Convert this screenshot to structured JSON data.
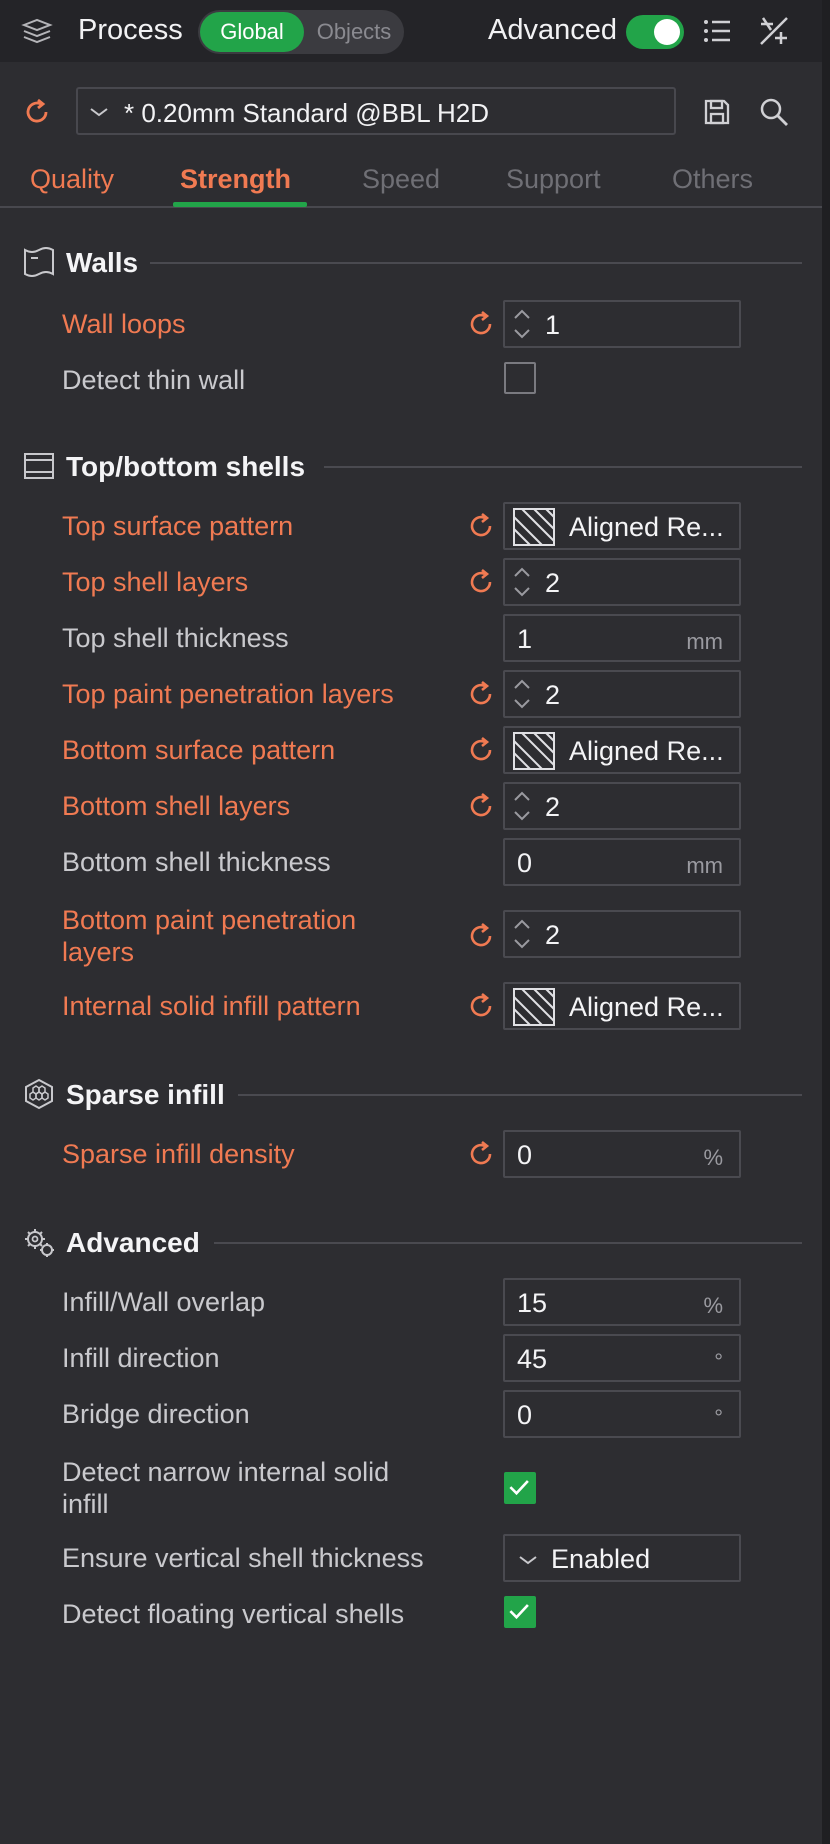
{
  "header": {
    "title": "Process",
    "seg_global": "Global",
    "seg_objects": "Objects",
    "advanced_label": "Advanced",
    "advanced_on": true
  },
  "preset": {
    "name": "* 0.20mm Standard @BBL H2D"
  },
  "tabs": [
    {
      "label": "Quality"
    },
    {
      "label": "Strength"
    },
    {
      "label": "Speed"
    },
    {
      "label": "Support"
    },
    {
      "label": "Others"
    }
  ],
  "active_tab": "Strength",
  "colors": {
    "accent_green": "#22a449",
    "modified_orange": "#f07a52",
    "background": "#2d2d31"
  },
  "walls": {
    "title": "Walls",
    "wall_loops": {
      "label": "Wall loops",
      "value": "1"
    },
    "detect_thin_wall": {
      "label": "Detect thin wall",
      "checked": false
    }
  },
  "top_bottom": {
    "title": "Top/bottom shells",
    "top_surface_pattern": {
      "label": "Top surface pattern",
      "value": "Aligned Re..."
    },
    "top_shell_layers": {
      "label": "Top shell layers",
      "value": "2"
    },
    "top_shell_thickness": {
      "label": "Top shell thickness",
      "value": "1",
      "unit": "mm"
    },
    "top_paint_layers": {
      "label": "Top paint penetration layers",
      "value": "2"
    },
    "bottom_surface_pattern": {
      "label": "Bottom surface pattern",
      "value": "Aligned Re..."
    },
    "bottom_shell_layers": {
      "label": "Bottom shell layers",
      "value": "2"
    },
    "bottom_shell_thickness": {
      "label": "Bottom shell thickness",
      "value": "0",
      "unit": "mm"
    },
    "bottom_paint_layers": {
      "label_line1": "Bottom paint penetration",
      "label_line2": "layers",
      "value": "2"
    },
    "internal_solid_pattern": {
      "label": "Internal solid infill pattern",
      "value": "Aligned Re..."
    }
  },
  "sparse": {
    "title": "Sparse infill",
    "density": {
      "label": "Sparse infill density",
      "value": "0",
      "unit": "%"
    }
  },
  "advanced": {
    "title": "Advanced",
    "overlap": {
      "label": "Infill/Wall overlap",
      "value": "15",
      "unit": "%"
    },
    "infill_direction": {
      "label": "Infill direction",
      "value": "45",
      "unit": "°"
    },
    "bridge_direction": {
      "label": "Bridge direction",
      "value": "0",
      "unit": "°"
    },
    "detect_narrow": {
      "label_line1": "Detect narrow internal solid",
      "label_line2": "infill",
      "checked": true
    },
    "ensure_vertical": {
      "label": "Ensure vertical shell thickness",
      "value": "Enabled"
    },
    "detect_floating": {
      "label": "Detect floating vertical shells",
      "checked": true
    }
  }
}
